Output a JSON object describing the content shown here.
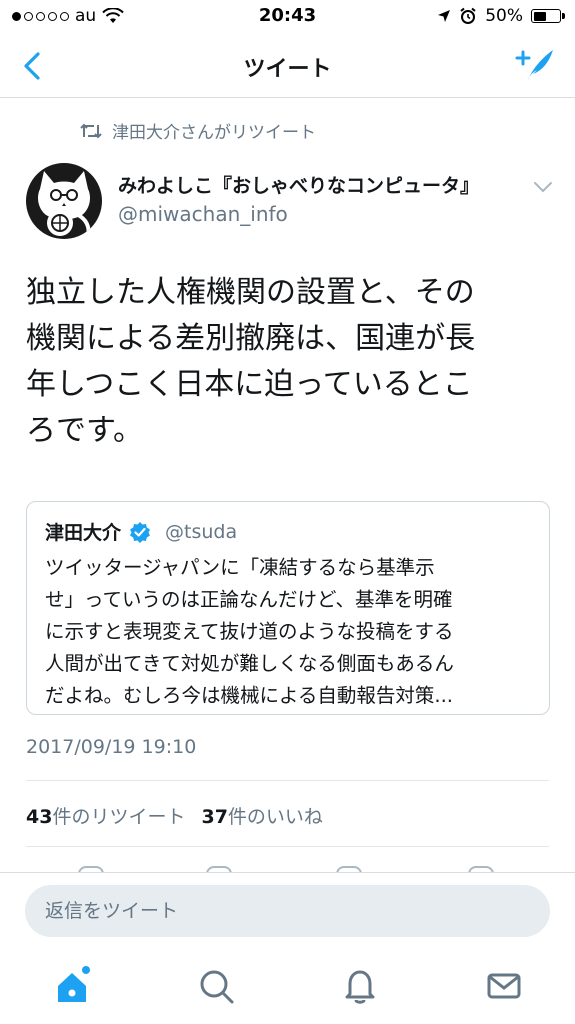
{
  "status_bar": {
    "carrier": "au",
    "time": "20:43",
    "battery": "50%",
    "battery_level": 0.5,
    "signal_bars": 1
  },
  "nav": {
    "title": "ツイート",
    "back_icon": "chevron-left-icon",
    "compose_icon": "compose-tweet-icon"
  },
  "retweet_line": {
    "text": "津田大介さんがリツイート",
    "icon": "retweet-icon"
  },
  "tweet": {
    "author_name": "みわよしこ『おしゃべりなコンピュータ』",
    "author_handle": "@miwachan_info",
    "text_lines": [
      "独立した人権機関の設置と、その",
      "機関による差別撤廃は、国連が長",
      "年しつこく日本に迫っているとこ",
      "ろです。"
    ],
    "timestamp": "2017/09/19 19:10",
    "retweet_count": "43",
    "retweet_label": "件のリツイート",
    "like_count": "37",
    "like_label": "件のいいね"
  },
  "quoted_tweet": {
    "name": "津田大介",
    "handle": "@tsuda",
    "verified": true,
    "text_lines": [
      "ツイッタージャパンに「凍結するなら基準示",
      "せ」っていうのは正論なんだけど、基準を明確",
      "に示すと表現変えて抜け道のような投稿をする",
      "人間が出てきて対処が難しくなる側面もあるん",
      "だよね。むしろ今は機械による自動報告対策..."
    ]
  },
  "reply": {
    "placeholder": "返信をツイート"
  },
  "tabs": [
    {
      "name": "home",
      "icon": "home-icon",
      "active": true
    },
    {
      "name": "search",
      "icon": "search-icon",
      "active": false
    },
    {
      "name": "notifications",
      "icon": "bell-icon",
      "active": false
    },
    {
      "name": "messages",
      "icon": "mail-icon",
      "active": false
    }
  ],
  "colors": {
    "accent": "#1da1f2",
    "text": "#14171a",
    "secondary": "#657786",
    "border": "#e1e8ed",
    "input_bg": "#e6ecf0"
  }
}
